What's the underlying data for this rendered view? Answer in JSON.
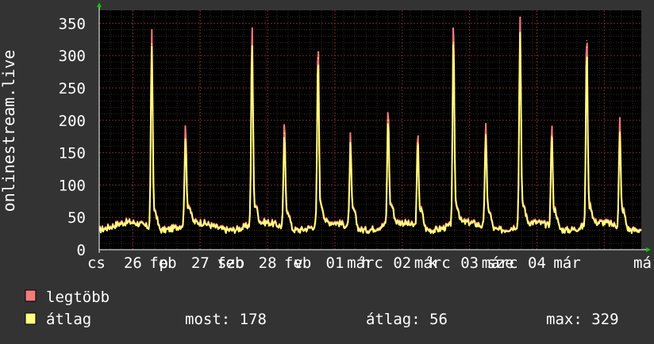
{
  "chart_data": {
    "type": "line",
    "ylabel": "onlinestream.live",
    "ylim": [
      0,
      370
    ],
    "yticks": [
      0,
      50,
      100,
      150,
      200,
      250,
      300,
      350
    ],
    "grid": true,
    "x_tick_labels": [
      "cs 26 feb",
      "p 27 feb",
      "szo 28 feb",
      "v 01 márc",
      "h 02 márc",
      "k 03 márc",
      "sze 04 márc"
    ],
    "x_label_fragments": [
      "cs",
      "26",
      "feb",
      "p",
      "27",
      "feb",
      "szo",
      "28",
      "feb",
      "v",
      "01",
      "márc",
      "h",
      "02",
      "márc",
      "k",
      "03",
      "márc",
      "sze",
      "04",
      "már"
    ],
    "series": [
      {
        "name": "legtöbb",
        "color": "#f47a7a",
        "peaks": [
          {
            "day": 0.78,
            "value": 331
          },
          {
            "day": 1.28,
            "value": 183
          },
          {
            "day": 2.27,
            "value": 329
          },
          {
            "day": 2.75,
            "value": 193
          },
          {
            "day": 3.25,
            "value": 306
          },
          {
            "day": 3.73,
            "value": 168
          },
          {
            "day": 4.29,
            "value": 210
          },
          {
            "day": 4.73,
            "value": 172
          },
          {
            "day": 5.26,
            "value": 333
          },
          {
            "day": 5.74,
            "value": 189
          },
          {
            "day": 6.25,
            "value": 345
          },
          {
            "day": 6.72,
            "value": 186
          },
          {
            "day": 7.24,
            "value": 323
          },
          {
            "day": 7.73,
            "value": 193
          }
        ]
      },
      {
        "name": "átlag",
        "color": "#ffff80",
        "peaks": [
          {
            "day": 0.78,
            "value": 318
          },
          {
            "day": 1.28,
            "value": 170
          },
          {
            "day": 2.27,
            "value": 314
          },
          {
            "day": 2.75,
            "value": 180
          },
          {
            "day": 3.25,
            "value": 296
          },
          {
            "day": 3.73,
            "value": 160
          },
          {
            "day": 4.29,
            "value": 200
          },
          {
            "day": 4.73,
            "value": 165
          },
          {
            "day": 5.26,
            "value": 320
          },
          {
            "day": 5.74,
            "value": 178
          },
          {
            "day": 6.25,
            "value": 335
          },
          {
            "day": 6.72,
            "value": 175
          },
          {
            "day": 7.24,
            "value": 313
          },
          {
            "day": 7.73,
            "value": 178
          }
        ]
      }
    ]
  },
  "legend": {
    "max_label": "legtöbb",
    "avg_label": "átlag",
    "max_color": "#f47a7a",
    "avg_color": "#ffff80"
  },
  "stats": {
    "current": "most: 178",
    "average": "átlag: 56",
    "maximum": "max: 329"
  }
}
